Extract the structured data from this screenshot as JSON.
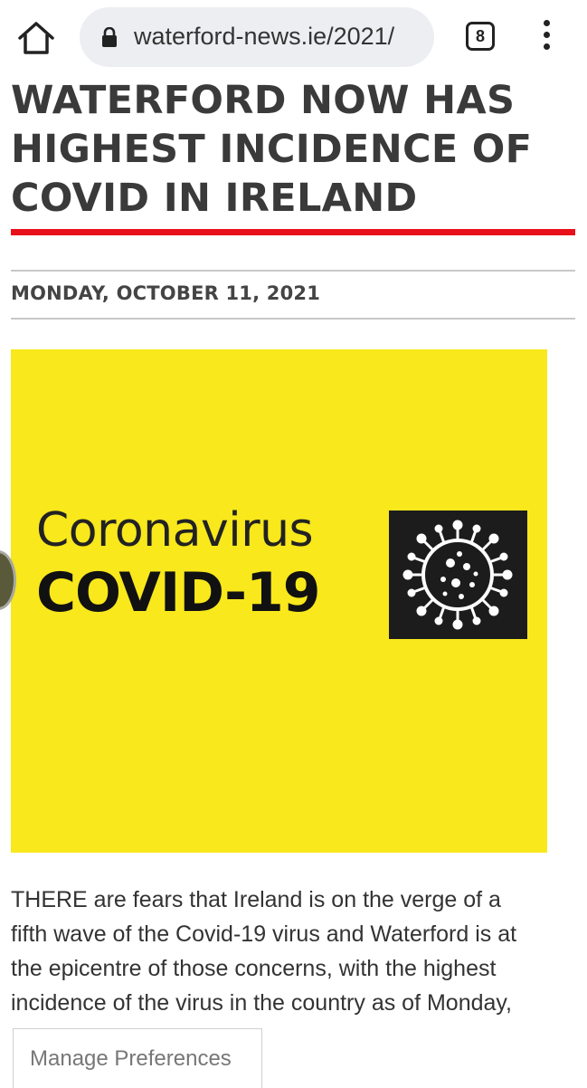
{
  "browser": {
    "url": "waterford-news.ie/2021/",
    "tab_count": "8"
  },
  "article": {
    "headline_lines": [
      "WATERFORD NOW HAS",
      "HIGHEST INCIDENCE OF",
      "COVID IN IRELAND"
    ],
    "date": "MONDAY, OCTOBER 11, 2021",
    "image": {
      "line1": "Coronavirus",
      "line2": "COVID-19",
      "background": "#f8e81c",
      "icon": "virus-icon"
    },
    "body_lines": [
      "THERE are fears that Ireland is on the verge of a",
      "fifth wave of the Covid-19 virus and Waterford is at",
      "the epicentre of those concerns, with the highest",
      "incidence of the virus in the country as of Monday,"
    ]
  },
  "consent": {
    "manage_label": "Manage Preferences"
  },
  "colors": {
    "accent_rule": "#e8101a",
    "headline": "#3a3a3a"
  }
}
